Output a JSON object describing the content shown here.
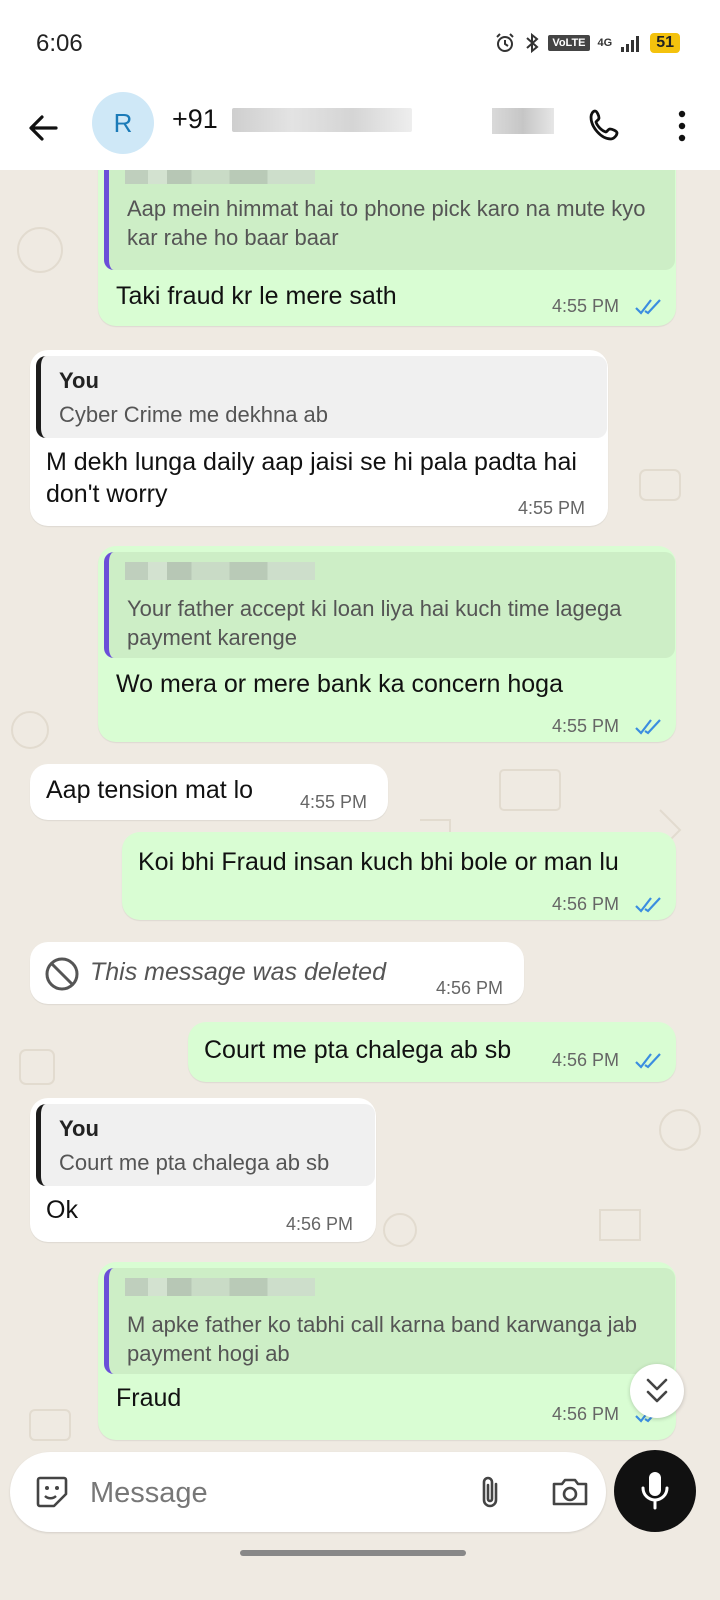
{
  "status": {
    "time": "6:06",
    "network": "4G",
    "volte": "VoLTE",
    "battery": "51"
  },
  "header": {
    "avatar_letter": "R",
    "contact_prefix": "+91"
  },
  "messages": [
    {
      "dir": "out",
      "quote_text": "Aap mein himmat hai to phone pick karo na mute kyo kar rahe ho baar baar",
      "text": "Taki fraud kr le mere sath",
      "time": "4:55 PM"
    },
    {
      "dir": "in",
      "quote_author": "You",
      "quote_text": "Cyber Crime me dekhna ab",
      "text": "M dekh lunga daily aap jaisi se hi pala padta hai don't worry",
      "time": "4:55 PM"
    },
    {
      "dir": "out",
      "quote_text": "Your father accept ki loan liya hai kuch time lagega payment karenge",
      "text": "Wo mera or mere bank ka concern hoga",
      "time": "4:55 PM"
    },
    {
      "dir": "in",
      "text": "Aap tension mat lo",
      "time": "4:55 PM"
    },
    {
      "dir": "out",
      "text": "Koi bhi Fraud insan kuch bhi bole or man lu",
      "time": "4:56 PM"
    },
    {
      "dir": "in",
      "deleted": true,
      "text": "This message was deleted",
      "time": "4:56 PM"
    },
    {
      "dir": "out",
      "text": "Court me pta chalega ab sb",
      "time": "4:56 PM"
    },
    {
      "dir": "in",
      "quote_author": "You",
      "quote_text": "Court me pta chalega ab sb",
      "text": "Ok",
      "time": "4:56 PM"
    },
    {
      "dir": "out",
      "quote_text": "M apke father ko tabhi call karna band karwanga jab payment hogi ab",
      "text": "Fraud",
      "time": "4:56 PM"
    }
  ],
  "composer": {
    "placeholder": "Message"
  },
  "colors": {
    "outgoing": "#d9fdd3",
    "incoming": "#ffffff",
    "tick": "#3b8de0",
    "quote_bar": "#6b4fd8"
  }
}
